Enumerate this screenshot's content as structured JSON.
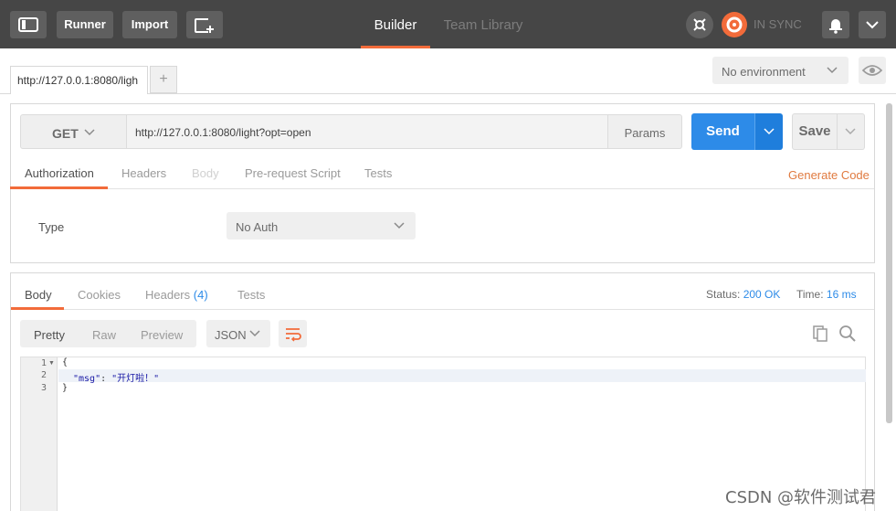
{
  "header": {
    "sidebar_toggle_icon": "sidebar-icon",
    "runner_label": "Runner",
    "import_label": "Import",
    "new_tab_icon": "new-window-icon",
    "nav_tabs": [
      {
        "label": "Builder",
        "active": true
      },
      {
        "label": "Team Library",
        "active": false
      }
    ],
    "interceptor_icon": "satellite-icon",
    "sync_icon": "sync-icon",
    "sync_status": "IN SYNC",
    "notifications_icon": "bell-icon",
    "menu_icon": "chevron-down-icon",
    "accent_color": "#f26b3a"
  },
  "request_tabs": {
    "tabs": [
      {
        "label": "http://127.0.0.1:8080/ligh"
      }
    ],
    "add_label": "+"
  },
  "environment": {
    "selected": "No environment",
    "eye_icon": "eye-icon"
  },
  "request": {
    "method": "GET",
    "url": "http://127.0.0.1:8080/light?opt=open",
    "params_label": "Params",
    "send_label": "Send",
    "save_label": "Save",
    "send_color": "#2d8be8",
    "tabs": [
      {
        "label": "Authorization",
        "active": true
      },
      {
        "label": "Headers",
        "active": false
      },
      {
        "label": "Body",
        "disabled": true
      },
      {
        "label": "Pre-request Script",
        "active": false
      },
      {
        "label": "Tests",
        "active": false
      }
    ],
    "generate_code_label": "Generate Code",
    "auth": {
      "type_label": "Type",
      "selected": "No Auth"
    }
  },
  "response": {
    "tabs": [
      {
        "label": "Body",
        "active": true
      },
      {
        "label": "Cookies",
        "active": false
      },
      {
        "label": "Headers",
        "count": "(4)",
        "active": false
      },
      {
        "label": "Tests",
        "active": false
      }
    ],
    "status_label": "Status:",
    "status_value": "200 OK",
    "time_label": "Time:",
    "time_value": "16 ms",
    "format_buttons": [
      {
        "label": "Pretty",
        "active": true
      },
      {
        "label": "Raw",
        "active": false
      },
      {
        "label": "Preview",
        "active": false
      }
    ],
    "format_select": "JSON",
    "wrap_icon": "wrap-lines-icon",
    "copy_icon": "copy-icon",
    "search_icon": "search-icon",
    "code_lines": [
      {
        "num": "1",
        "text": "{"
      },
      {
        "num": "2",
        "key": "\"msg\"",
        "sep": ": ",
        "value": "\"开灯啦！\""
      },
      {
        "num": "3",
        "text": "}"
      }
    ]
  },
  "watermark": "CSDN @软件测试君"
}
